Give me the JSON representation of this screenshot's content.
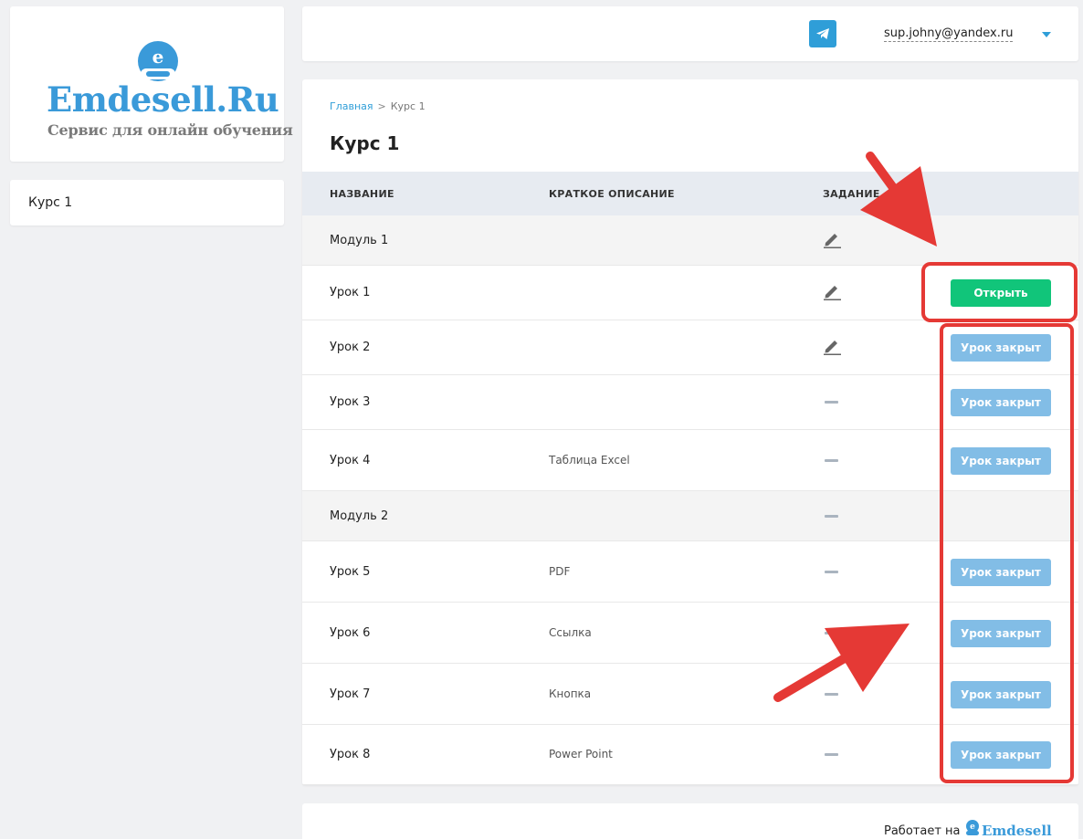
{
  "brand": {
    "title": "Emdesell.Ru",
    "subtitle": "Сервис для онлайн обучения",
    "accent_color": "#3a9ad9"
  },
  "sidebar": {
    "items": [
      {
        "label": "Курс 1"
      }
    ]
  },
  "header": {
    "telegram_icon": "telegram-icon",
    "user_email": "sup.johny@yandex.ru"
  },
  "breadcrumb": {
    "home": "Главная",
    "separator": ">",
    "current": "Курс 1"
  },
  "page": {
    "title": "Курс 1"
  },
  "table": {
    "columns": {
      "name": "НАЗВАНИЕ",
      "description": "КРАТКОЕ ОПИСАНИЕ",
      "task": "ЗАДАНИЕ"
    },
    "rows": [
      {
        "name": "Модуль 1",
        "description": "",
        "task": "edit",
        "status": "",
        "type": "module"
      },
      {
        "name": "Урок 1",
        "description": "",
        "task": "edit",
        "status": "Открыть",
        "type": "lesson"
      },
      {
        "name": "Урок 2",
        "description": "",
        "task": "edit",
        "status": "Урок закрыт",
        "type": "lesson"
      },
      {
        "name": "Урок 3",
        "description": "",
        "task": "none",
        "status": "Урок закрыт",
        "type": "lesson"
      },
      {
        "name": "Урок 4",
        "description": "Таблица Excel",
        "task": "none",
        "status": "Урок закрыт",
        "type": "lesson"
      },
      {
        "name": "Модуль 2",
        "description": "",
        "task": "none",
        "status": "",
        "type": "module"
      },
      {
        "name": "Урок 5",
        "description": "PDF",
        "task": "none",
        "status": "Урок закрыт",
        "type": "lesson"
      },
      {
        "name": "Урок 6",
        "description": "Ссылка",
        "task": "none",
        "status": "Урок закрыт",
        "type": "lesson"
      },
      {
        "name": "Урок 7",
        "description": "Кнопка",
        "task": "none",
        "status": "Урок закрыт",
        "type": "lesson"
      },
      {
        "name": "Урок 8",
        "description": "Power Point",
        "task": "none",
        "status": "Урок закрыт",
        "type": "lesson"
      }
    ]
  },
  "footer": {
    "powered_by": "Работает на",
    "brand": "Emdesell"
  },
  "colors": {
    "open_button": "#11c57a",
    "closed_button": "#82bde6",
    "annotation": "#e53935"
  }
}
